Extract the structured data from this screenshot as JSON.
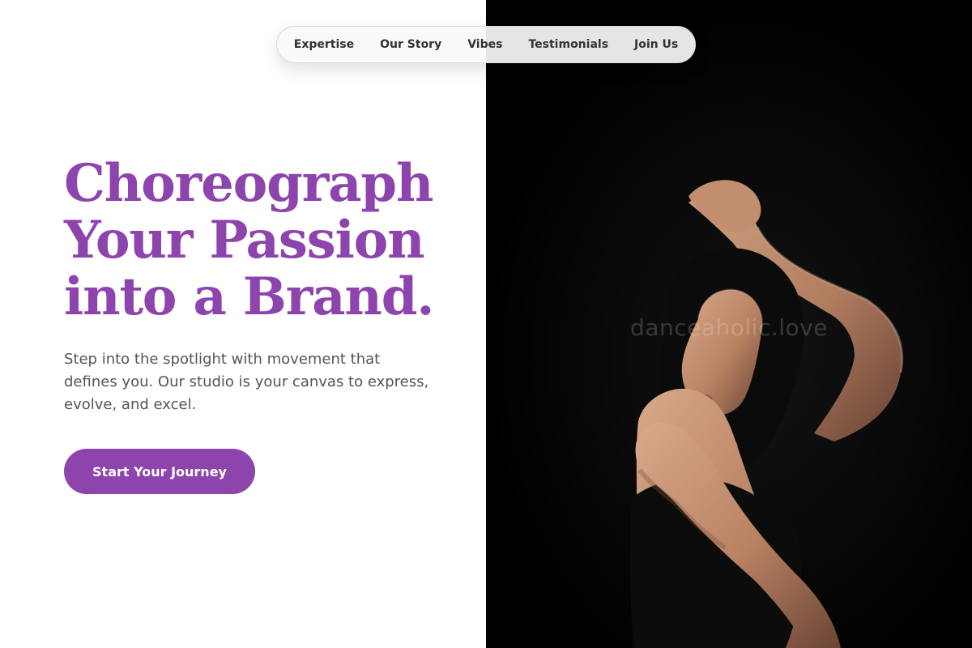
{
  "nav": {
    "items": [
      {
        "label": "Expertise"
      },
      {
        "label": "Our Story"
      },
      {
        "label": "Vibes"
      },
      {
        "label": "Testimonials"
      },
      {
        "label": "Join Us"
      }
    ]
  },
  "hero": {
    "headline_lines": [
      "Choreograph",
      "Your Passion",
      "into a Brand."
    ],
    "subtext": "Step into the spotlight with movement that defines you. Our studio is your canvas to express, evolve, and excel.",
    "cta_label": "Start Your Journey"
  },
  "image": {
    "watermark": "danceaholic.love"
  },
  "colors": {
    "accent": "#8e44ad",
    "text_muted": "#555555",
    "nav_text": "#333333",
    "image_bg": "#000000"
  }
}
